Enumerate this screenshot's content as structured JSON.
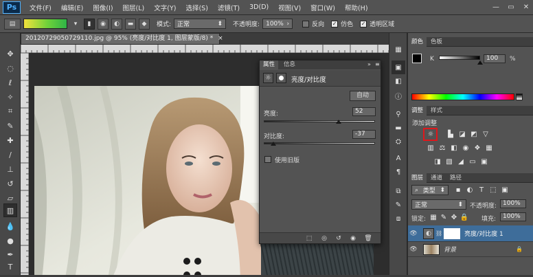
{
  "app": {
    "logo": "Ps"
  },
  "menu": [
    "文件(F)",
    "编辑(E)",
    "图像(I)",
    "图层(L)",
    "文字(Y)",
    "选择(S)",
    "滤镜(T)",
    "3D(D)",
    "视图(V)",
    "窗口(W)",
    "帮助(H)"
  ],
  "window_controls": {
    "minimize": "—",
    "restore": "▭",
    "close": "✕"
  },
  "options": {
    "mode_label": "模式:",
    "mode_value": "正常",
    "opacity_label": "不透明度:",
    "opacity_value": "100%",
    "reverse_label": "反向",
    "dither_label": "仿色",
    "transparency_label": "透明区域"
  },
  "document": {
    "tab_title": "20120729050729110.jpg @ 95% (亮度/对比度 1, 图层蒙版/8) *",
    "close": "×"
  },
  "properties": {
    "tab_props": "属性",
    "tab_info": "信息",
    "header_title": "亮度/对比度",
    "auto_button": "自动",
    "brightness_label": "亮度:",
    "brightness_value": "52",
    "brightness": 52,
    "contrast_label": "对比度:",
    "contrast_value": "-37",
    "contrast": -37,
    "legacy_label": "使用旧版"
  },
  "color_panel": {
    "tab_color": "颜色",
    "tab_swatches": "色板",
    "k_label": "K",
    "k_value": "100",
    "k_unit": "%",
    "k_level": 100
  },
  "adjustments": {
    "tab_adjust": "调整",
    "tab_styles": "样式",
    "title": "添加调整"
  },
  "layers": {
    "tab_layers": "图层",
    "tab_channels": "通道",
    "tab_paths": "路径",
    "filter_kind": "类型",
    "blend_mode": "正常",
    "opacity_label": "不透明度:",
    "opacity_value": "100%",
    "lock_label": "锁定:",
    "fill_label": "填充:",
    "fill_value": "100%",
    "items": [
      {
        "name": "亮度/对比度 1"
      },
      {
        "name": "背景"
      }
    ]
  },
  "colors": {
    "selection_highlight": "#e0171b",
    "ui_panel": "#535353"
  }
}
